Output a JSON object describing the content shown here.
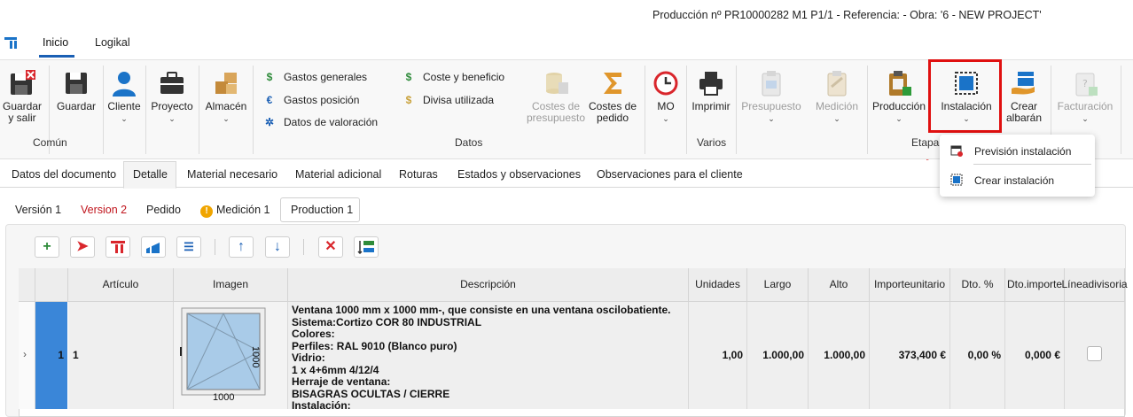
{
  "window": {
    "title": "Producción nº PR10000282 M1 P1/1 - Referencia:  - Obra: '6 - NEW PROJECT'"
  },
  "top_tabs": [
    {
      "label": "Inicio"
    },
    {
      "label": "Logikal"
    }
  ],
  "ribbon": {
    "groups": {
      "comun": "Común",
      "datos": "Datos",
      "varios": "Varios",
      "etapa": "Etapa"
    },
    "guardar_y_salir": [
      "Guardar",
      "y salir"
    ],
    "guardar": "Guardar",
    "cliente": "Cliente",
    "proyecto": "Proyecto",
    "almacen": "Almacén",
    "gastos_generales": "Gastos generales",
    "gastos_posicion": "Gastos posición",
    "datos_valoracion": "Datos de valoración",
    "coste_beneficio": "Coste y beneficio",
    "divisa_utilizada": "Divisa utilizada",
    "costes_presupuesto": [
      "Costes de",
      "presupuesto"
    ],
    "costes_pedido": [
      "Costes de",
      "pedido"
    ],
    "mo": "MO",
    "imprimir": "Imprimir",
    "presupuesto": "Presupuesto",
    "medicion": "Medición",
    "produccion": "Producción",
    "instalacion": "Instalación",
    "crear_albaran": [
      "Crear",
      "albarán"
    ],
    "facturacion": "Facturación"
  },
  "dropdown": {
    "items": [
      {
        "label": "Previsión instalación"
      },
      {
        "label": "Crear instalación"
      }
    ]
  },
  "doc_tabs": [
    {
      "label": "Datos del documento"
    },
    {
      "label": "Detalle"
    },
    {
      "label": "Material necesario"
    },
    {
      "label": "Material adicional"
    },
    {
      "label": "Roturas"
    },
    {
      "label": "Estados y observaciones"
    },
    {
      "label": "Observaciones para el cliente"
    }
  ],
  "version_tabs": [
    {
      "label": "Versión 1"
    },
    {
      "label": "Version 2"
    },
    {
      "label": "Pedido"
    },
    {
      "label": "Medición 1"
    },
    {
      "label": "Production 1"
    }
  ],
  "table": {
    "headers": {
      "articulo": "Artículo",
      "imagen": "Imagen",
      "descripcion": "Descripción",
      "unidades": "Unidades",
      "largo": "Largo",
      "alto": "Alto",
      "importe_unitario": [
        "Importe",
        "unitario"
      ],
      "dto_pct": "Dto. %",
      "dto_importe": [
        "Dto.",
        "importe"
      ],
      "linea_divisoria": [
        "Línea",
        "divisoria"
      ]
    },
    "row": {
      "pos": "1",
      "articulo": "1",
      "img_width": "1000",
      "img_height": "1000",
      "descripcion": [
        "Ventana 1000 mm x 1000 mm-, que consiste en una ventana oscilobatiente.",
        "Sistema:Cortizo COR 80 INDUSTRIAL",
        "Colores:",
        "Perfiles: RAL 9010 (Blanco puro)",
        "Vidrio:",
        "1 x 4+6mm 4/12/4",
        "Herraje de ventana:",
        "BISAGRAS OCULTAS / CIERRE",
        "Instalación:"
      ],
      "unidades": "1,00",
      "largo": "1.000,00",
      "alto": "1.000,00",
      "importe_unitario": "373,400 €",
      "dto_pct": "0,00 %",
      "dto_importe": "0,000 €"
    }
  },
  "colors": {
    "accent": "#1a5fb4",
    "highlight": "#e01010",
    "version2": "#c0141c",
    "row_select": "#3a86d8"
  }
}
